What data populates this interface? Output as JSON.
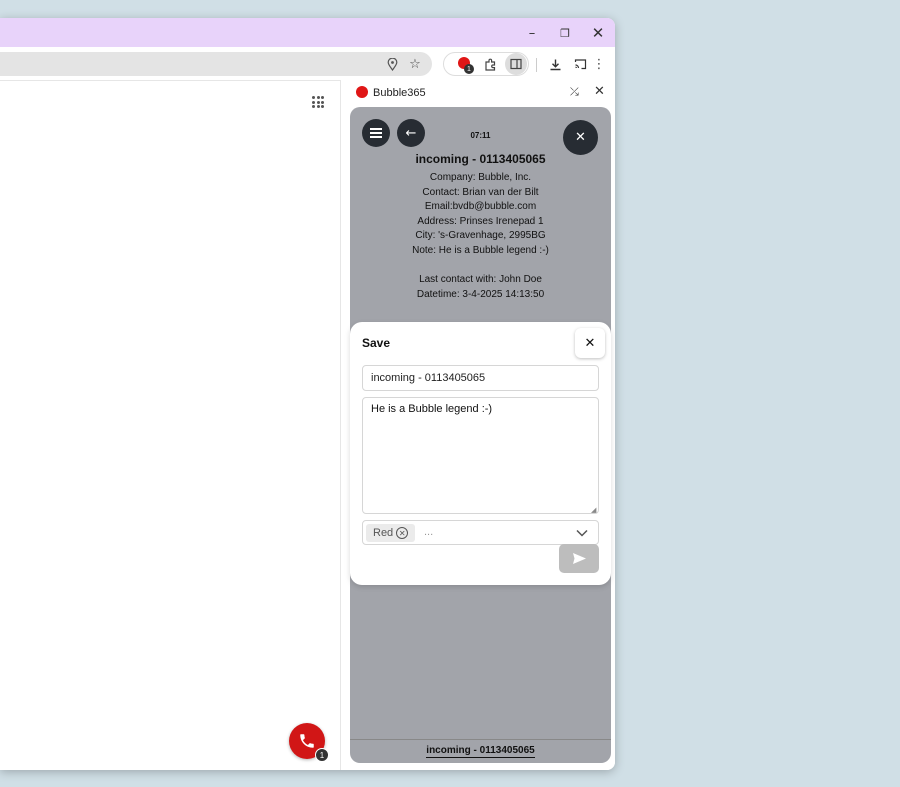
{
  "colors": {
    "titlebar": "#e8d3fa",
    "accent": "#d11616",
    "app_bg": "#a2a4aa",
    "dark_button": "#272c33"
  },
  "browser": {
    "window_controls": {
      "minimize_icon": "minimize-icon",
      "restore_icon": "restore-icon",
      "close_icon": "close-icon"
    },
    "extension_badge": "1"
  },
  "page": {
    "fab_badge": "1"
  },
  "side_panel": {
    "title": "Bubble365",
    "app": {
      "timer": "07:11",
      "call_title": "incoming - 0113405065",
      "info": {
        "company": "Company: Bubble, Inc.",
        "contact": "Contact: Brian van der Bilt",
        "email": "Email:bvdb@bubble.com",
        "address": "Address: Prinses Irenepad 1",
        "city": "City: 's-Gravenhage, 2995BG",
        "note": "Note: He is a Bubble legend :-)",
        "last_contact": "Last contact with: John Doe",
        "datetime": "Datetime: 3-4-2025 14:13:50"
      },
      "footer": "incoming - 0113405065"
    },
    "modal": {
      "title": "Save",
      "subject": "incoming - 0113405065",
      "note": "He is a Bubble legend :-)",
      "tags": [
        {
          "label": "Red"
        }
      ],
      "tags_placeholder": "..."
    }
  }
}
